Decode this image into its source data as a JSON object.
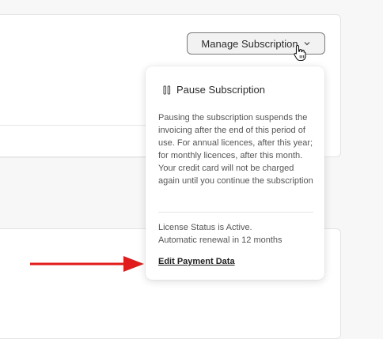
{
  "manage_button": {
    "label": "Manage Subscription"
  },
  "dropdown": {
    "pause_label": "Pause Subscription",
    "pause_description": "Pausing the subscription suspends the invoicing after the end of this period of use. For annual licences, after this year; for monthly licences, after this month. Your credit card will not be charged again until you continue the subscription",
    "status_line1": "License Status is Active.",
    "status_line2": "Automatic renewal in 12 months",
    "edit_payment_label": "Edit Payment Data"
  },
  "colors": {
    "arrow": "#e11b1b",
    "button_border": "#7a7a7a",
    "background": "#f7f7f7"
  },
  "icons": {
    "pause": "pause-icon",
    "chevron": "chevron-down-icon",
    "cursor": "hand-pointer-cursor-icon",
    "arrow": "red-annotation-arrow-icon"
  }
}
